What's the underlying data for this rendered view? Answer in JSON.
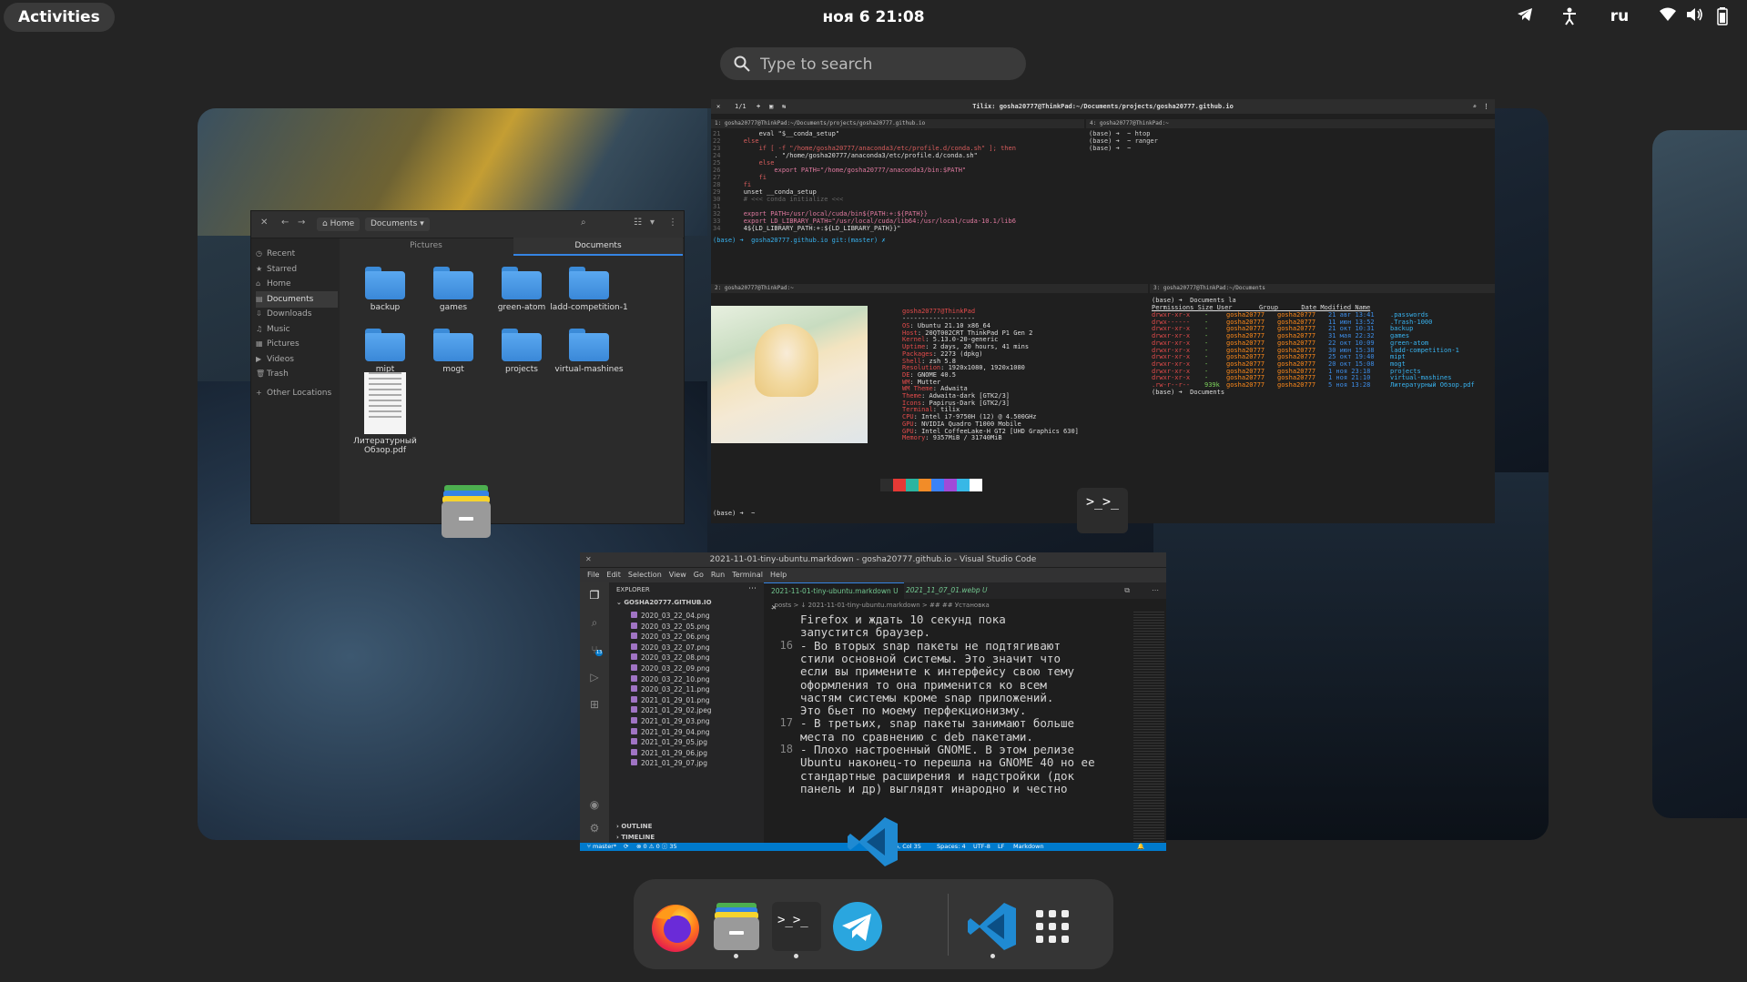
{
  "topbar": {
    "activities": "Activities",
    "clock": "ноя 6  21:08",
    "language": "ru"
  },
  "search": {
    "placeholder": "Type to search"
  },
  "files": {
    "crumb_home": "Home",
    "crumb_documents": "Documents",
    "tab_pictures": "Pictures",
    "tab_documents": "Documents",
    "sidebar": [
      {
        "icon": "clock-icon",
        "label": "Recent"
      },
      {
        "icon": "star-icon",
        "label": "Starred"
      },
      {
        "icon": "home-icon",
        "label": "Home"
      },
      {
        "icon": "document-icon",
        "label": "Documents"
      },
      {
        "icon": "download-icon",
        "label": "Downloads"
      },
      {
        "icon": "music-icon",
        "label": "Music"
      },
      {
        "icon": "picture-icon",
        "label": "Pictures"
      },
      {
        "icon": "video-icon",
        "label": "Videos"
      },
      {
        "icon": "trash-icon",
        "label": "Trash"
      },
      {
        "icon": "plus-icon",
        "label": "Other Locations"
      }
    ],
    "items": [
      {
        "label": "backup"
      },
      {
        "label": "games"
      },
      {
        "label": "green-atom"
      },
      {
        "label": "ladd-competition-1"
      },
      {
        "label": "mipt"
      },
      {
        "label": "mogt"
      },
      {
        "label": "projects"
      },
      {
        "label": "virtual-mashines"
      },
      {
        "label": "Литературный Обзор.pdf"
      }
    ]
  },
  "tilix": {
    "tab_counter": "1/1",
    "title": "Tilix: gosha20777@ThinkPad:~/Documents/projects/gosha20777.github.io",
    "pane1_title": "1: gosha20777@ThinkPad:~/Documents/projects/gosha20777.github.io",
    "pane2_title": "2: gosha20777@ThinkPad:~",
    "pane3_title": "3: gosha20777@ThinkPad:~/Documents",
    "pane4_title": "4: gosha20777@ThinkPad:~",
    "code_lines": [
      "        eval \"$__conda_setup\"",
      "    else",
      "        if [ -f \"/home/gosha20777/anaconda3/etc/profile.d/conda.sh\" ]; then",
      "            . \"/home/gosha20777/anaconda3/etc/profile.d/conda.sh\"",
      "        else",
      "            export PATH=\"/home/gosha20777/anaconda3/bin:$PATH\"",
      "        fi",
      "    fi",
      "    unset __conda_setup",
      "    # <<< conda initialize <<<",
      "",
      "    export PATH=/usr/local/cuda/bin${PATH:+:${PATH}}",
      "    export LD_LIBRARY_PATH=\"/usr/local/cuda/lib64:/usr/local/cuda-10.1/lib6",
      "    4${LD_LIBRARY_PATH:+:${LD_LIBRARY_PATH}}\""
    ],
    "pane1_prompt": "(base) ➜  gosha20777.github.io git:(master) ✗ ",
    "pane4_lines": [
      "(base) ➜  ~ htop",
      "(base) ➜  ~ ranger",
      "(base) ➜  ~ "
    ],
    "neofetch_user": "gosha20777@ThinkPad",
    "neofetch_sep": "-------------------",
    "neofetch": [
      {
        "k": "OS",
        "v": "Ubuntu 21.10 x86_64"
      },
      {
        "k": "Host",
        "v": "20QT002CRT ThinkPad P1 Gen 2"
      },
      {
        "k": "Kernel",
        "v": "5.13.0-20-generic"
      },
      {
        "k": "Uptime",
        "v": "2 days, 20 hours, 41 mins"
      },
      {
        "k": "Packages",
        "v": "2273 (dpkg)"
      },
      {
        "k": "Shell",
        "v": "zsh 5.8"
      },
      {
        "k": "Resolution",
        "v": "1920x1080, 1920x1080"
      },
      {
        "k": "DE",
        "v": "GNOME 40.5"
      },
      {
        "k": "WM",
        "v": "Mutter"
      },
      {
        "k": "WM Theme",
        "v": "Adwaita"
      },
      {
        "k": "Theme",
        "v": "Adwaita-dark [GTK2/3]"
      },
      {
        "k": "Icons",
        "v": "Papirus-Dark [GTK2/3]"
      },
      {
        "k": "Terminal",
        "v": "tilix"
      },
      {
        "k": "CPU",
        "v": "Intel i7-9750H (12) @ 4.500GHz"
      },
      {
        "k": "GPU",
        "v": "NVIDIA Quadro T1000 Mobile"
      },
      {
        "k": "GPU",
        "v": "Intel CoffeeLake-H GT2 [UHD Graphics 630]"
      },
      {
        "k": "Memory",
        "v": "9357MiB / 31740MiB"
      }
    ],
    "pane2_prompt": "(base) ➜  ~ ",
    "swatches": [
      "#2d2d2d",
      "#e53935",
      "#2bb5a0",
      "#f28c28",
      "#3b82f6",
      "#a14ad8",
      "#37b8e6",
      "#ffffff"
    ],
    "ls_cmd": "(base) ➜  Documents la",
    "ls_header": "Permissions Size User       Group      Date Modified Name",
    "ls_rows": [
      {
        "p": "drwxr-xr-x",
        "s": "-",
        "u": "gosha20777",
        "g": "gosha20777",
        "d": "21 авг 13:41",
        "n": ".passwords"
      },
      {
        "p": "drwx------",
        "s": "-",
        "u": "gosha20777",
        "g": "gosha20777",
        "d": "11 июн 13:52",
        "n": ".Trash-1000"
      },
      {
        "p": "drwxr-xr-x",
        "s": "-",
        "u": "gosha20777",
        "g": "gosha20777",
        "d": "21 окт 10:31",
        "n": "backup"
      },
      {
        "p": "drwxr-xr-x",
        "s": "-",
        "u": "gosha20777",
        "g": "gosha20777",
        "d": "31 мая 22:32",
        "n": "games"
      },
      {
        "p": "drwxr-xr-x",
        "s": "-",
        "u": "gosha20777",
        "g": "gosha20777",
        "d": "22 окт 10:09",
        "n": "green-atom"
      },
      {
        "p": "drwxr-xr-x",
        "s": "-",
        "u": "gosha20777",
        "g": "gosha20777",
        "d": "30 июн 15:38",
        "n": "ladd-competition-1"
      },
      {
        "p": "drwxr-xr-x",
        "s": "-",
        "u": "gosha20777",
        "g": "gosha20777",
        "d": "25 окт 19:40",
        "n": "mipt"
      },
      {
        "p": "drwxr-xr-x",
        "s": "-",
        "u": "gosha20777",
        "g": "gosha20777",
        "d": "20 окт 15:08",
        "n": "mogt"
      },
      {
        "p": "drwxr-xr-x",
        "s": "-",
        "u": "gosha20777",
        "g": "gosha20777",
        "d": "1 ноя 23:18",
        "n": "projects"
      },
      {
        "p": "drwxr-xr-x",
        "s": "-",
        "u": "gosha20777",
        "g": "gosha20777",
        "d": "1 ноя 21:10",
        "n": "virtual-mashines"
      },
      {
        "p": ".rw-r--r--",
        "s": "939k",
        "u": "gosha20777",
        "g": "gosha20777",
        "d": "5 ноя 13:28",
        "n": "Литературный Обзор.pdf"
      }
    ],
    "pane3_prompt": "(base) ➜  Documents "
  },
  "vscode": {
    "title": "2021-11-01-tiny-ubuntu.markdown - gosha20777.github.io - Visual Studio Code",
    "menu": [
      "File",
      "Edit",
      "Selection",
      "View",
      "Go",
      "Run",
      "Terminal",
      "Help"
    ],
    "explorer_label": "EXPLORER",
    "root": "GOSHA20777.GITHUB.IO",
    "files": [
      "2020_03_22_04.png",
      "2020_03_22_05.png",
      "2020_03_22_06.png",
      "2020_03_22_07.png",
      "2020_03_22_08.png",
      "2020_03_22_09.png",
      "2020_03_22_10.png",
      "2020_03_22_11.png",
      "2021_01_29_01.png",
      "2021_01_29_02.jpeg",
      "2021_01_29_03.png",
      "2021_01_29_04.png",
      "2021_01_29_05.jpg",
      "2021_01_29_06.jpg",
      "2021_01_29_07.jpg"
    ],
    "outline": "OUTLINE",
    "timeline": "TIMELINE",
    "badge": "13",
    "tab1": "2021-11-01-tiny-ubuntu.markdown U",
    "tab2": "2021_11_07_01.webp U",
    "breadcrumb": "_posts > ↓ 2021-11-01-tiny-ubuntu.markdown > ## ## Установка",
    "code": [
      {
        "n": "",
        "t": "  Firefox и ждать 10 секунд пока"
      },
      {
        "n": "",
        "t": "  запустится браузер."
      },
      {
        "n": "16",
        "t": "  - Во вторых snap пакеты не подтягивают"
      },
      {
        "n": "",
        "t": "  стили основной системы. Это значит что"
      },
      {
        "n": "",
        "t": "  если вы примените к интерфейсу свою тему"
      },
      {
        "n": "",
        "t": "  оформления то она применится ко всем"
      },
      {
        "n": "",
        "t": "  частям системы кроме snap приложений."
      },
      {
        "n": "",
        "t": "  Это бьет по моему перфекционизму."
      },
      {
        "n": "17",
        "t": "  - В третьих, snap пакеты занимают больше"
      },
      {
        "n": "",
        "t": "  места по сравнению с deb пакетами."
      },
      {
        "n": "18",
        "t": "- Плохо настроенный GNOME. В этом релизе"
      },
      {
        "n": "",
        "t": "Ubuntu наконец-то перешла на GNOME 40 но ее"
      },
      {
        "n": "",
        "t": "стандартные расширения и надстройки (док"
      },
      {
        "n": "",
        "t": "панель и др) выглядят инародно и честно"
      }
    ],
    "status_branch": "master*",
    "status_problems": "⊗ 0 ⚠ 0 ⓘ 35",
    "status_position": "Ln 46, Col 35",
    "status_spaces": "Spaces: 4",
    "status_encoding": "UTF-8",
    "status_eol": "LF",
    "status_lang": "Markdown"
  },
  "dock": {
    "items": [
      {
        "name": "firefox-icon",
        "running": false
      },
      {
        "name": "files-icon",
        "running": true
      },
      {
        "name": "terminal-icon",
        "running": true
      },
      {
        "name": "telegram-icon",
        "running": false
      },
      {
        "name": "vscode-icon",
        "running": true
      },
      {
        "name": "show-apps-icon",
        "running": false
      }
    ]
  },
  "colors": {
    "accent": "#3584e4",
    "vscode_status": "#007acc",
    "folder": "#4a9be8"
  }
}
